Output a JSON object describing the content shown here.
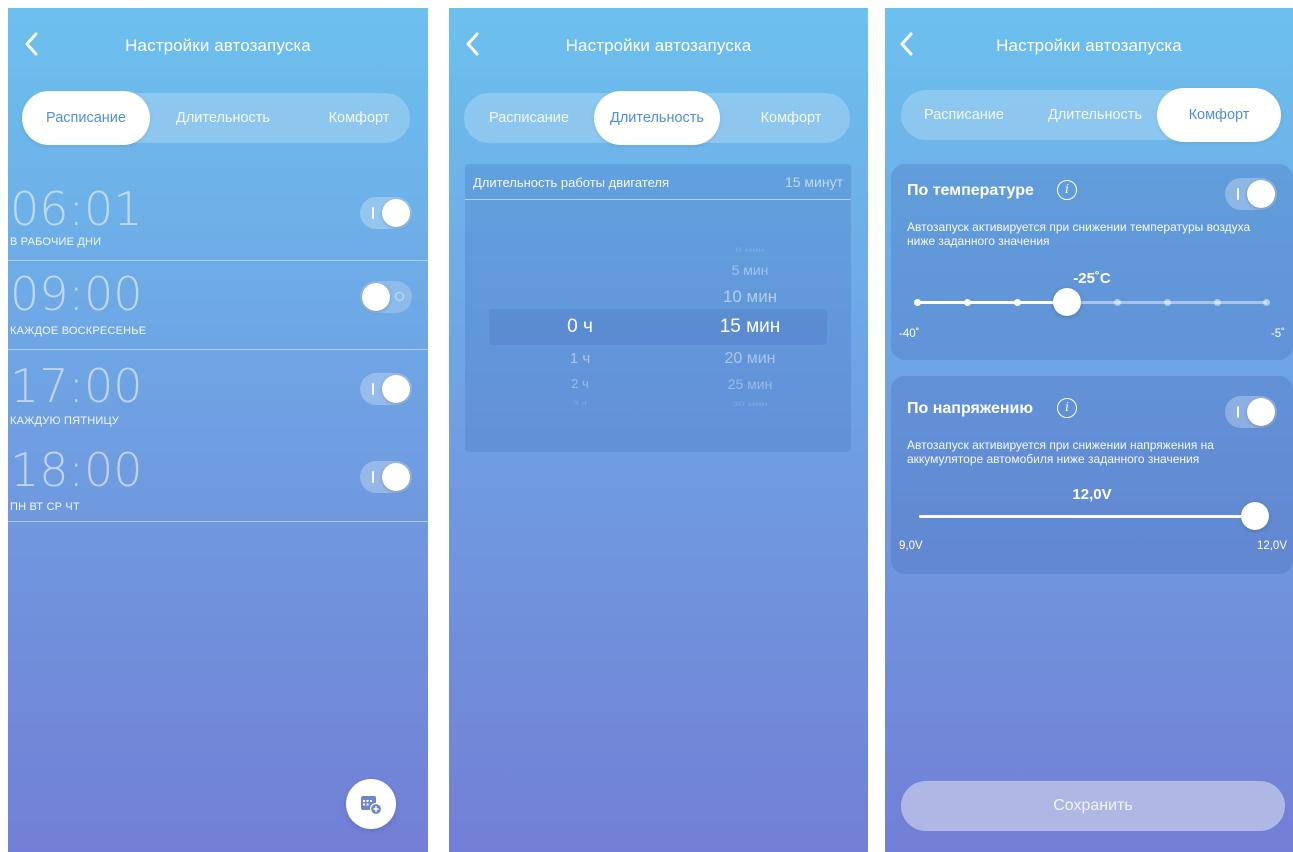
{
  "common": {
    "title": "Настройки автозапуска",
    "tabs": [
      "Расписание",
      "Длительность",
      "Комфорт"
    ]
  },
  "schedule": {
    "items": [
      {
        "time": "06:01",
        "label": "В РАБОЧИЕ ДНИ",
        "enabled": true
      },
      {
        "time": "09:00",
        "label": "КАЖДОЕ ВОСКРЕСЕНЬЕ",
        "enabled": false
      },
      {
        "time": "17:00",
        "label": "КАЖДУЮ ПЯТНИЦУ",
        "enabled": true
      },
      {
        "time": "18:00",
        "label": "ПН ВТ СР ЧТ",
        "enabled": true
      }
    ],
    "add_icon": "calendar-add-icon"
  },
  "duration": {
    "header_label": "Длительность работы двигателя",
    "header_value": "15 минут",
    "hours": [
      "0 ч",
      "1 ч",
      "2 ч",
      "3 ч"
    ],
    "minutes": [
      "0 мин",
      "5 мин",
      "10 мин",
      "15 мин",
      "20 мин",
      "25 мин",
      "30 мин"
    ],
    "selected_hours": "0 ч",
    "selected_minutes": "15 мин"
  },
  "comfort": {
    "temperature": {
      "title": "По температуре",
      "description": "Автозапуск активируется при снижении температуры воздуха ниже заданного значения",
      "value": "-25˚C",
      "min_label": "-40˚",
      "max_label": "-5˚",
      "level": 0.43,
      "enabled": true
    },
    "voltage": {
      "title": "По напряжению",
      "description": "Автозапуск активируется при снижении напряжения на аккумуляторе автомобиля ниже заданного значения",
      "value": "12,0V",
      "min_label": "9,0V",
      "max_label": "12,0V",
      "level": 1.0,
      "enabled": true
    },
    "save_label": "Сохранить"
  },
  "colors": {
    "gradient_top": "#6cc0ee",
    "gradient_bottom": "#727fd6",
    "active_tab_text": "#4d8ee0"
  }
}
